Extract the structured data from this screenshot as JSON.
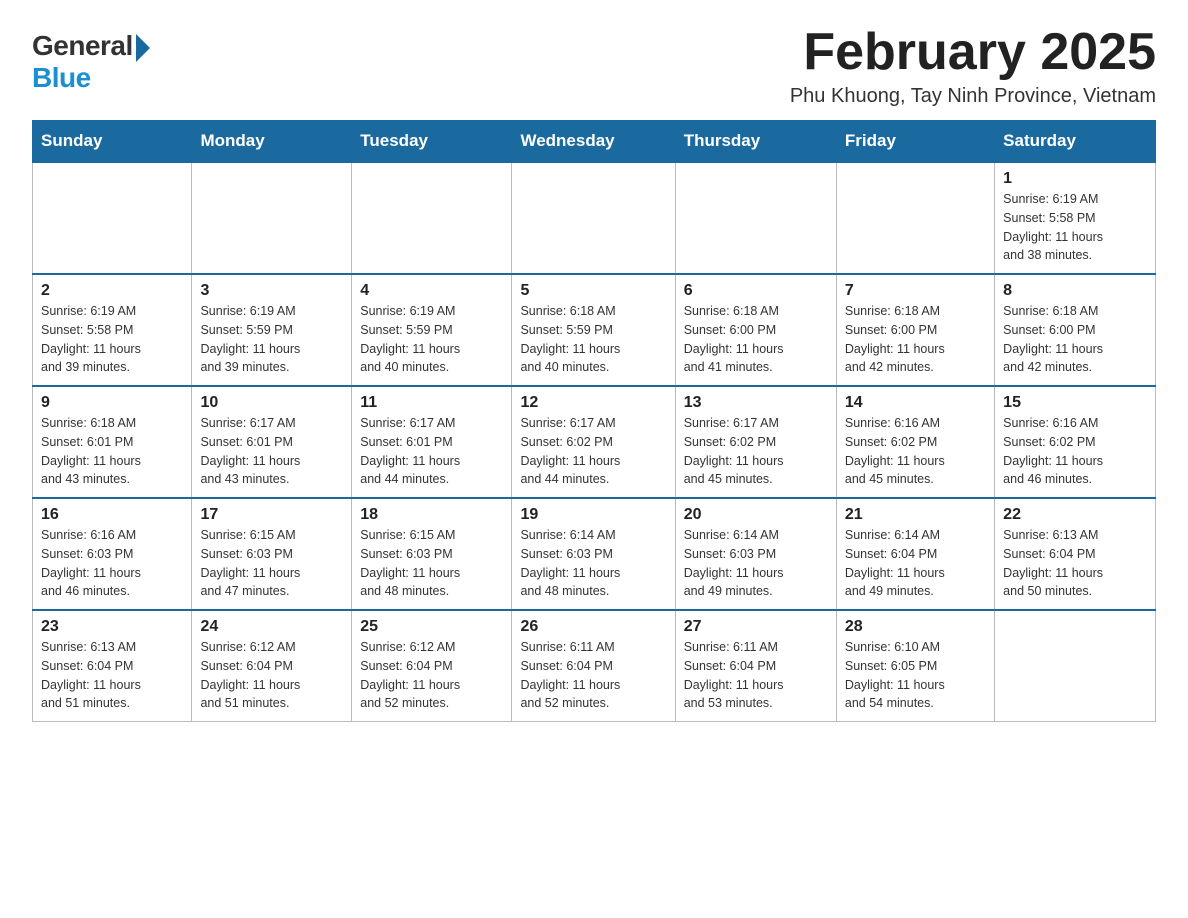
{
  "logo": {
    "general": "General",
    "blue": "Blue"
  },
  "header": {
    "month": "February 2025",
    "location": "Phu Khuong, Tay Ninh Province, Vietnam"
  },
  "weekdays": [
    "Sunday",
    "Monday",
    "Tuesday",
    "Wednesday",
    "Thursday",
    "Friday",
    "Saturday"
  ],
  "weeks": [
    {
      "days": [
        {
          "num": "",
          "info": ""
        },
        {
          "num": "",
          "info": ""
        },
        {
          "num": "",
          "info": ""
        },
        {
          "num": "",
          "info": ""
        },
        {
          "num": "",
          "info": ""
        },
        {
          "num": "",
          "info": ""
        },
        {
          "num": "1",
          "info": "Sunrise: 6:19 AM\nSunset: 5:58 PM\nDaylight: 11 hours\nand 38 minutes."
        }
      ]
    },
    {
      "days": [
        {
          "num": "2",
          "info": "Sunrise: 6:19 AM\nSunset: 5:58 PM\nDaylight: 11 hours\nand 39 minutes."
        },
        {
          "num": "3",
          "info": "Sunrise: 6:19 AM\nSunset: 5:59 PM\nDaylight: 11 hours\nand 39 minutes."
        },
        {
          "num": "4",
          "info": "Sunrise: 6:19 AM\nSunset: 5:59 PM\nDaylight: 11 hours\nand 40 minutes."
        },
        {
          "num": "5",
          "info": "Sunrise: 6:18 AM\nSunset: 5:59 PM\nDaylight: 11 hours\nand 40 minutes."
        },
        {
          "num": "6",
          "info": "Sunrise: 6:18 AM\nSunset: 6:00 PM\nDaylight: 11 hours\nand 41 minutes."
        },
        {
          "num": "7",
          "info": "Sunrise: 6:18 AM\nSunset: 6:00 PM\nDaylight: 11 hours\nand 42 minutes."
        },
        {
          "num": "8",
          "info": "Sunrise: 6:18 AM\nSunset: 6:00 PM\nDaylight: 11 hours\nand 42 minutes."
        }
      ]
    },
    {
      "days": [
        {
          "num": "9",
          "info": "Sunrise: 6:18 AM\nSunset: 6:01 PM\nDaylight: 11 hours\nand 43 minutes."
        },
        {
          "num": "10",
          "info": "Sunrise: 6:17 AM\nSunset: 6:01 PM\nDaylight: 11 hours\nand 43 minutes."
        },
        {
          "num": "11",
          "info": "Sunrise: 6:17 AM\nSunset: 6:01 PM\nDaylight: 11 hours\nand 44 minutes."
        },
        {
          "num": "12",
          "info": "Sunrise: 6:17 AM\nSunset: 6:02 PM\nDaylight: 11 hours\nand 44 minutes."
        },
        {
          "num": "13",
          "info": "Sunrise: 6:17 AM\nSunset: 6:02 PM\nDaylight: 11 hours\nand 45 minutes."
        },
        {
          "num": "14",
          "info": "Sunrise: 6:16 AM\nSunset: 6:02 PM\nDaylight: 11 hours\nand 45 minutes."
        },
        {
          "num": "15",
          "info": "Sunrise: 6:16 AM\nSunset: 6:02 PM\nDaylight: 11 hours\nand 46 minutes."
        }
      ]
    },
    {
      "days": [
        {
          "num": "16",
          "info": "Sunrise: 6:16 AM\nSunset: 6:03 PM\nDaylight: 11 hours\nand 46 minutes."
        },
        {
          "num": "17",
          "info": "Sunrise: 6:15 AM\nSunset: 6:03 PM\nDaylight: 11 hours\nand 47 minutes."
        },
        {
          "num": "18",
          "info": "Sunrise: 6:15 AM\nSunset: 6:03 PM\nDaylight: 11 hours\nand 48 minutes."
        },
        {
          "num": "19",
          "info": "Sunrise: 6:14 AM\nSunset: 6:03 PM\nDaylight: 11 hours\nand 48 minutes."
        },
        {
          "num": "20",
          "info": "Sunrise: 6:14 AM\nSunset: 6:03 PM\nDaylight: 11 hours\nand 49 minutes."
        },
        {
          "num": "21",
          "info": "Sunrise: 6:14 AM\nSunset: 6:04 PM\nDaylight: 11 hours\nand 49 minutes."
        },
        {
          "num": "22",
          "info": "Sunrise: 6:13 AM\nSunset: 6:04 PM\nDaylight: 11 hours\nand 50 minutes."
        }
      ]
    },
    {
      "days": [
        {
          "num": "23",
          "info": "Sunrise: 6:13 AM\nSunset: 6:04 PM\nDaylight: 11 hours\nand 51 minutes."
        },
        {
          "num": "24",
          "info": "Sunrise: 6:12 AM\nSunset: 6:04 PM\nDaylight: 11 hours\nand 51 minutes."
        },
        {
          "num": "25",
          "info": "Sunrise: 6:12 AM\nSunset: 6:04 PM\nDaylight: 11 hours\nand 52 minutes."
        },
        {
          "num": "26",
          "info": "Sunrise: 6:11 AM\nSunset: 6:04 PM\nDaylight: 11 hours\nand 52 minutes."
        },
        {
          "num": "27",
          "info": "Sunrise: 6:11 AM\nSunset: 6:04 PM\nDaylight: 11 hours\nand 53 minutes."
        },
        {
          "num": "28",
          "info": "Sunrise: 6:10 AM\nSunset: 6:05 PM\nDaylight: 11 hours\nand 54 minutes."
        },
        {
          "num": "",
          "info": ""
        }
      ]
    }
  ]
}
